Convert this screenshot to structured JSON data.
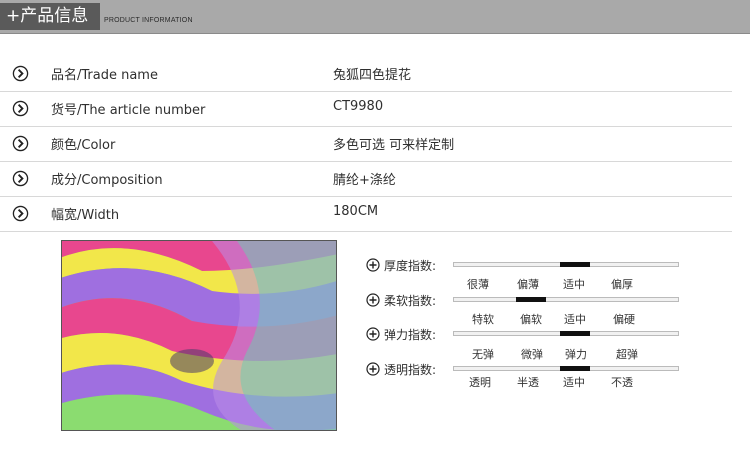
{
  "header": {
    "title": "+产品信息",
    "subtitle": "PRODUCT INFORMATION"
  },
  "specs": [
    {
      "label": "品名/Trade name",
      "value": "兔狐四色提花"
    },
    {
      "label": "货号/The article number",
      "value": "CT9980"
    },
    {
      "label": "颜色/Color",
      "value": "多色可选   可来样定制"
    },
    {
      "label": "成分/Composition",
      "value": "腈纶+涤纶"
    },
    {
      "label": "幅宽/Width",
      "value": "180CM"
    }
  ],
  "ratings": [
    {
      "name": "厚度指数:",
      "options": [
        "很薄",
        "偏薄",
        "适中",
        "偏厚"
      ],
      "selected": 2
    },
    {
      "name": "柔软指数:",
      "options": [
        "特软",
        "偏软",
        "适中",
        "偏硬"
      ],
      "selected": 1
    },
    {
      "name": "弹力指数:",
      "options": [
        "无弹",
        "微弹",
        "弹力",
        "超弹"
      ],
      "selected": 2
    },
    {
      "name": "透明指数:",
      "options": [
        "透明",
        "半透",
        "适中",
        "不透"
      ],
      "selected": 2
    }
  ],
  "colors": {
    "header_bg": "#a9a9a9",
    "tag_bg": "#5a5a5a",
    "marker": "#111111"
  },
  "icons": {
    "row_bullet": "circle-arrow-right-icon",
    "rating_bullet": "circle-plus-icon"
  }
}
